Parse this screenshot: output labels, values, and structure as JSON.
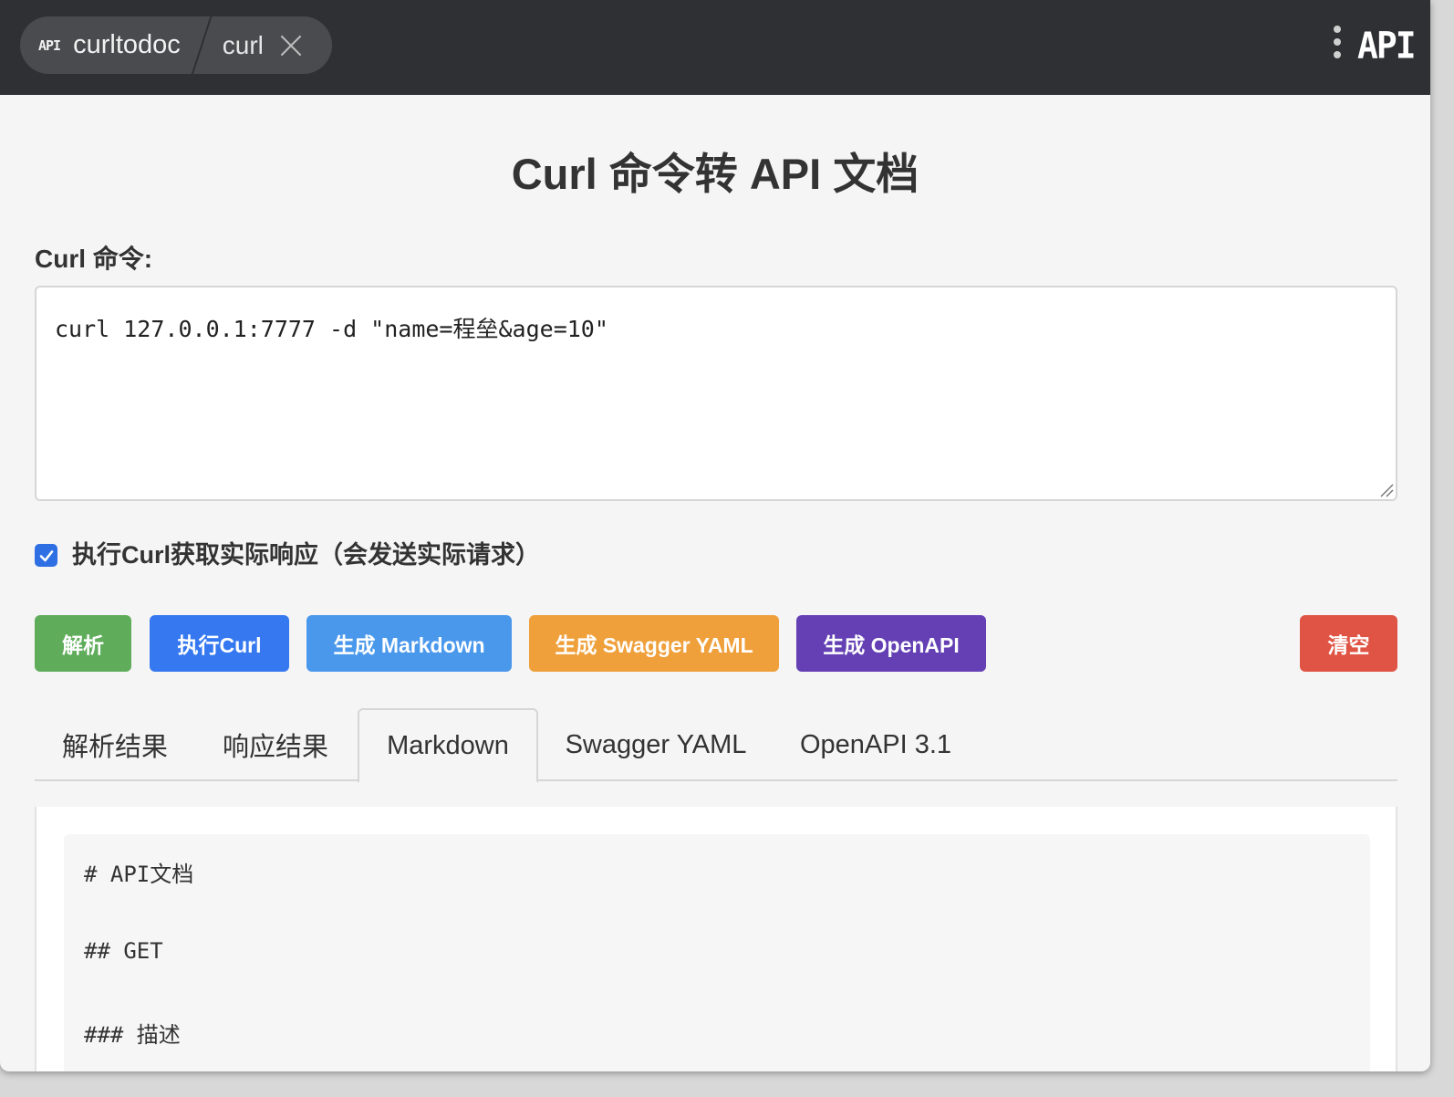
{
  "titlebar": {
    "mini_logo": "API",
    "app_name": "curltodoc",
    "tab_name": "curl",
    "logo_text": "API"
  },
  "page": {
    "title": "Curl 命令转 API 文档",
    "field_label": "Curl 命令:",
    "curl_command": "curl 127.0.0.1:7777 -d \"name=程垒&age=10\"",
    "execute_checkbox": {
      "checked": true,
      "label": "执行Curl获取实际响应（会发送实际请求）"
    }
  },
  "buttons": {
    "parse": "解析",
    "execute": "执行Curl",
    "markdown": "生成 Markdown",
    "swagger": "生成 Swagger YAML",
    "openapi": "生成 OpenAPI",
    "clear": "清空"
  },
  "colors": {
    "parse": "#5fad5b",
    "execute": "#3578f0",
    "markdown": "#4a98ec",
    "swagger": "#efa03b",
    "openapi": "#6440b4",
    "clear": "#e05445"
  },
  "tabs": [
    {
      "label": "解析结果",
      "active": false
    },
    {
      "label": "响应结果",
      "active": false
    },
    {
      "label": "Markdown",
      "active": true
    },
    {
      "label": "Swagger YAML",
      "active": false
    },
    {
      "label": "OpenAPI 3.1",
      "active": false
    }
  ],
  "output": {
    "lines": [
      "# API文档",
      "## GET",
      "### 描述"
    ]
  }
}
